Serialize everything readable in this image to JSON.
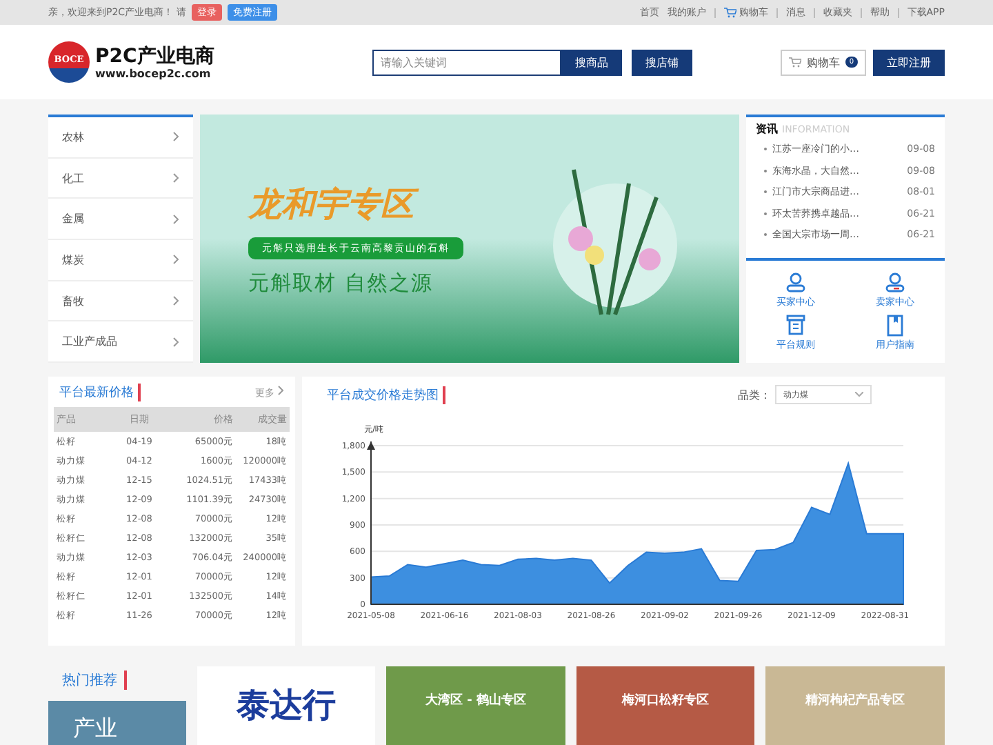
{
  "topbar": {
    "greeting": "亲，欢迎来到P2C产业电商！ 请",
    "login": "登录",
    "register": "免费注册",
    "links": [
      {
        "label": "首页",
        "kind": "plain"
      },
      {
        "label": "我的账户",
        "kind": "plain"
      },
      {
        "label": "购物车",
        "kind": "cart"
      },
      {
        "label": "消息",
        "kind": "plain"
      },
      {
        "label": "收藏夹",
        "kind": "plain"
      },
      {
        "label": "帮助",
        "kind": "plain"
      },
      {
        "label": "下载APP",
        "kind": "plain"
      }
    ]
  },
  "header": {
    "logo_mark": "BOCE",
    "logo_title": "P2C产业电商",
    "logo_url": "www.bocep2c.com",
    "search": {
      "placeholder": "请输入关键词"
    },
    "search_buttons": [
      "搜商品",
      "搜店铺"
    ],
    "cart": {
      "label": "购物车",
      "count": "0"
    },
    "register_button": "立即注册"
  },
  "categories": [
    "农林",
    "化工",
    "金属",
    "煤炭",
    "畜牧",
    "工业产成品"
  ],
  "banner": {
    "title": "龙和宇专区",
    "ribbon": "元斛只选用生长于云南高黎贡山的石斛",
    "slogan": "元斛取材 自然之源"
  },
  "news": {
    "title": "资讯",
    "subtitle": "INFORMATION",
    "items": [
      {
        "title": "江苏一座冷门的小…",
        "date": "09-08"
      },
      {
        "title": "东海水晶，大自然…",
        "date": "09-08"
      },
      {
        "title": "江门市大宗商品进…",
        "date": "08-01"
      },
      {
        "title": "环太苦荞携卓越品…",
        "date": "06-21"
      },
      {
        "title": "全国大宗市场一周…",
        "date": "06-21"
      }
    ]
  },
  "shortcuts": [
    {
      "label": "买家中心",
      "kind": "buyer"
    },
    {
      "label": "卖家中心",
      "kind": "seller"
    },
    {
      "label": "平台规则",
      "kind": "rules"
    },
    {
      "label": "用户指南",
      "kind": "guide"
    }
  ],
  "prices": {
    "title": "平台最新价格",
    "more": "更多",
    "columns": [
      "产品",
      "日期",
      "价格",
      "成交量"
    ],
    "rows": [
      [
        "松籽",
        "04-19",
        "65000元",
        "18吨"
      ],
      [
        "动力煤",
        "04-12",
        "1600元",
        "120000吨"
      ],
      [
        "动力煤",
        "12-15",
        "1024.51元",
        "17433吨"
      ],
      [
        "动力煤",
        "12-09",
        "1101.39元",
        "24730吨"
      ],
      [
        "松籽",
        "12-08",
        "70000元",
        "12吨"
      ],
      [
        "松籽仁",
        "12-08",
        "132000元",
        "35吨"
      ],
      [
        "动力煤",
        "12-03",
        "706.04元",
        "240000吨"
      ],
      [
        "松籽",
        "12-01",
        "70000元",
        "12吨"
      ],
      [
        "松籽仁",
        "12-01",
        "132500元",
        "14吨"
      ],
      [
        "松籽",
        "11-26",
        "70000元",
        "12吨"
      ]
    ]
  },
  "trend": {
    "title": "平台成交价格走势图",
    "filter_label": "品类：",
    "filter_value": "动力煤",
    "chart_data": {
      "type": "area",
      "ylabel": "元/吨",
      "categories": [
        "2021-05-08",
        null,
        null,
        null,
        "2021-06-16",
        null,
        null,
        null,
        "2021-08-03",
        null,
        null,
        null,
        "2021-08-26",
        null,
        null,
        null,
        "2021-09-02",
        null,
        null,
        null,
        "2021-09-26",
        null,
        null,
        null,
        "2021-12-09",
        null,
        null,
        null,
        "2022-08-31",
        null
      ],
      "series": [
        {
          "color": "#3d8fe0",
          "values": [
            310,
            320,
            450,
            420,
            460,
            500,
            450,
            440,
            510,
            520,
            500,
            520,
            500,
            240,
            440,
            590,
            580,
            590,
            630,
            270,
            260,
            610,
            620,
            700,
            1100,
            1020,
            1600,
            800,
            800,
            800
          ]
        }
      ],
      "ylim": [
        0,
        1800
      ],
      "grid": true,
      "yticks": [
        {
          "value": 0,
          "label": "0"
        },
        {
          "value": 300,
          "label": "300"
        },
        {
          "value": 600,
          "label": "600"
        },
        {
          "value": 900,
          "label": "900"
        },
        {
          "value": 1200,
          "label": "1,200"
        },
        {
          "value": 1500,
          "label": "1,500"
        },
        {
          "value": 1800,
          "label": "1,800"
        }
      ]
    }
  },
  "hot": {
    "title": "热门推荐",
    "side_label": "产业",
    "cards": [
      {
        "label": "泰达行",
        "kind": "logo"
      },
      {
        "label": "大湾区 - 鹤山专区",
        "kind": "photo"
      },
      {
        "label": "梅河口松籽专区",
        "kind": "photo"
      },
      {
        "label": "精河枸杞产品专区",
        "kind": "photo"
      }
    ]
  }
}
